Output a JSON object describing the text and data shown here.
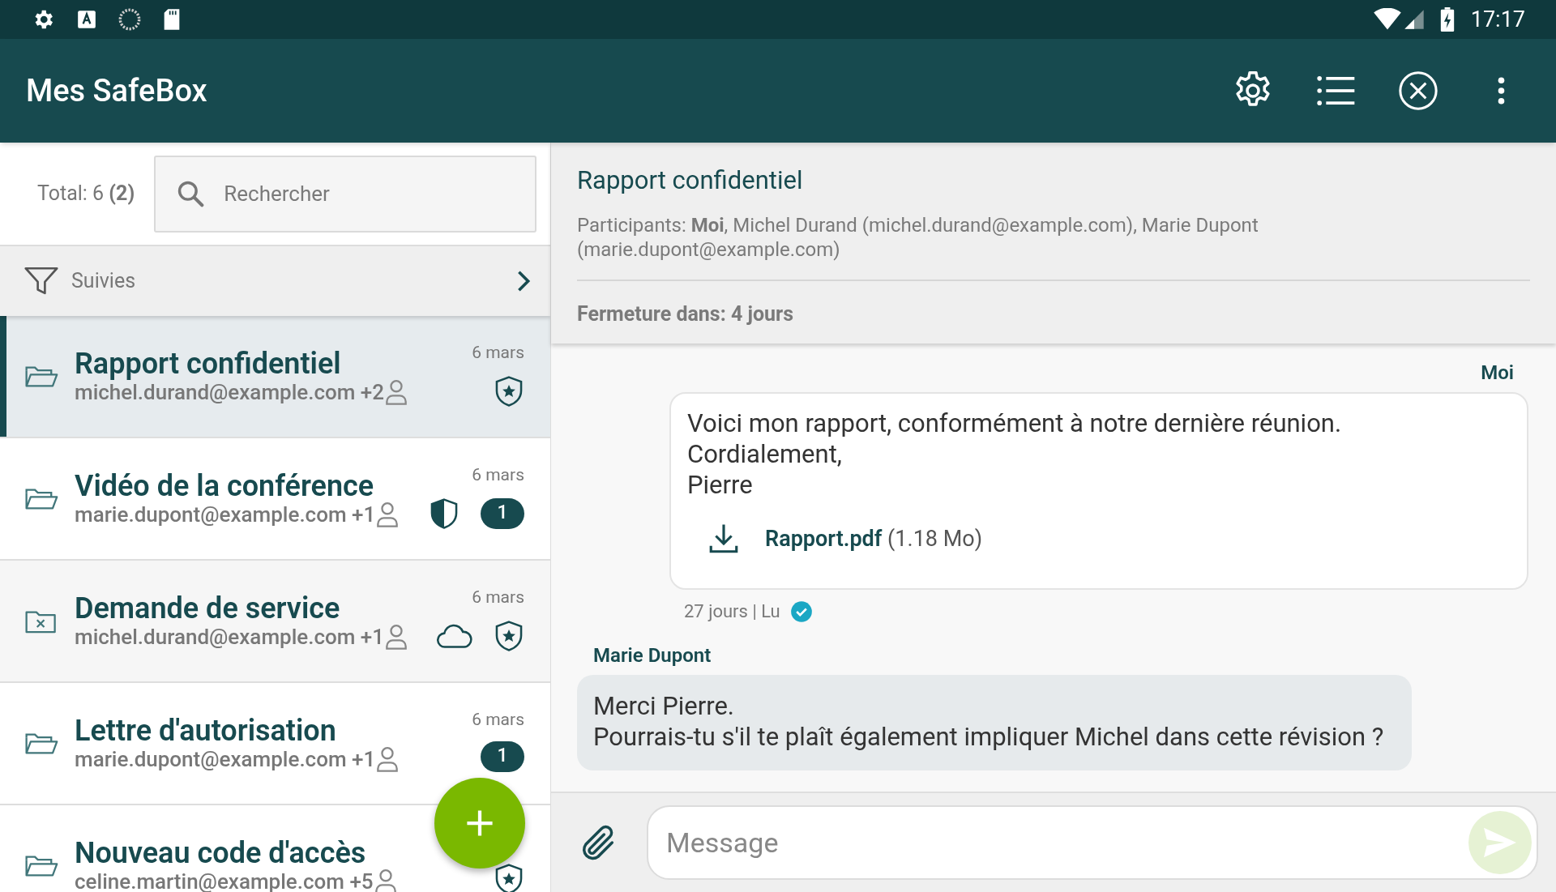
{
  "status_bar": {
    "time": "17:17"
  },
  "app_bar": {
    "title": "Mes SafeBox"
  },
  "list_header": {
    "total": "Total: 6 **(2)**",
    "search": {
      "placeholder": "Rechercher"
    },
    "filter": "Suivies"
  },
  "safeboxes": [
    {
      "title": "Rapport confidentiel",
      "participant": "michel.durand@example.com",
      "extra": "+2",
      "date": "6 mars",
      "selected": true,
      "closed": false,
      "starred": true,
      "shielded": false,
      "cloud": false
    },
    {
      "title": "Vidéo de la conférence",
      "participant": "marie.dupont@example.com",
      "extra": "+1",
      "date": "6 mars",
      "selected": false,
      "closed": false,
      "starred": false,
      "shielded": true,
      "cloud": false,
      "badge": "1"
    },
    {
      "title": "Demande de service",
      "participant": "michel.durand@example.com",
      "extra": "+1",
      "date": "6 mars",
      "selected": false,
      "closed": true,
      "starred": true,
      "shielded": false,
      "cloud": true
    },
    {
      "title": "Lettre d'autorisation",
      "participant": "marie.dupont@example.com",
      "extra": "+1",
      "date": "6 mars",
      "selected": false,
      "closed": false,
      "starred": false,
      "shielded": false,
      "cloud": false,
      "badge": "1"
    },
    {
      "title": "Nouveau code d'accès",
      "participant": "celine.martin@example.com",
      "extra": "+5",
      "selected": false,
      "closed": false,
      "starred": true,
      "shielded": false,
      "cloud": false
    }
  ],
  "detail": {
    "title": "Rapport confidentiel",
    "participants": "Participants: **Moi**, Michel Durand (michel.durand@example.com), Marie Dupont (marie.dupont@example.com)",
    "closing": "Fermeture dans: 4 jours"
  },
  "messages": [
    {
      "kind": "mine",
      "author": "Moi",
      "lines": [
        "Voici mon rapport, conformément à notre dernière réunion.",
        "Cordialement,",
        "Pierre"
      ],
      "attachment": {
        "name": "Rapport.pdf",
        "size": "(1.18 Mo)"
      },
      "meta": "27 jours | Lu",
      "read": true
    },
    {
      "kind": "theirs",
      "author": "Marie Dupont",
      "lines": [
        "Merci Pierre.",
        "Pourrais-tu s'il te plaît également impliquer Michel dans cette révision ?"
      ]
    }
  ],
  "composer": {
    "placeholder": "Message"
  }
}
